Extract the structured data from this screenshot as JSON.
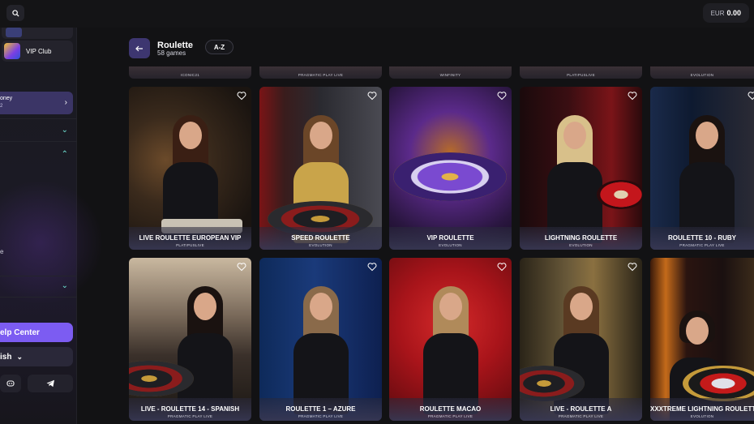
{
  "topbar": {
    "search_icon": "search-icon",
    "balance_currency": "EUR",
    "balance_amount": "0.00"
  },
  "sidebar": {
    "vip_label": "VIP Club",
    "money_label": "oney",
    "money_sub": "2",
    "partial_e": "e",
    "help_label": "elp Center",
    "language_label": "ish",
    "social": [
      "discord-icon",
      "telegram-icon"
    ]
  },
  "header": {
    "back_icon": "arrow-left-icon",
    "title": "Roulette",
    "count": "58 games",
    "sort_label": "A-Z"
  },
  "partial_row": [
    "ICONIC21",
    "PRAGMATIC PLAY LIVE",
    "WINFINITY",
    "PLATIPUSLIVE",
    "EVOLUTION"
  ],
  "games": [
    {
      "name": "LIVE ROULETTE EUROPEAN VIP",
      "provider": "PLATIPUSLIVE"
    },
    {
      "name": "SPEED ROULETTE",
      "provider": "EVOLUTION"
    },
    {
      "name": "VIP ROULETTE",
      "provider": "EVOLUTION"
    },
    {
      "name": "LIGHTNING ROULETTE",
      "provider": "EVOLUTION"
    },
    {
      "name": "ROULETTE 10 - RUBY",
      "provider": "PRAGMATIC PLAY LIVE"
    },
    {
      "name": "LIVE - ROULETTE 14 - SPANISH",
      "provider": "PRAGMATIC PLAY LIVE"
    },
    {
      "name": "ROULETTE 1 – AZURE",
      "provider": "PRAGMATIC PLAY LIVE"
    },
    {
      "name": "ROULETTE MACAO",
      "provider": "PRAGMATIC PLAY LIVE"
    },
    {
      "name": "LIVE - ROULETTE A",
      "provider": "PRAGMATIC PLAY LIVE"
    },
    {
      "name": "XXXTREME LIGHTNING ROULETTE",
      "provider": "EVOLUTION"
    }
  ],
  "colors": {
    "accent": "#7c5cf2",
    "background": "#121214",
    "sidebar_chevron": "#6fe3d4"
  }
}
